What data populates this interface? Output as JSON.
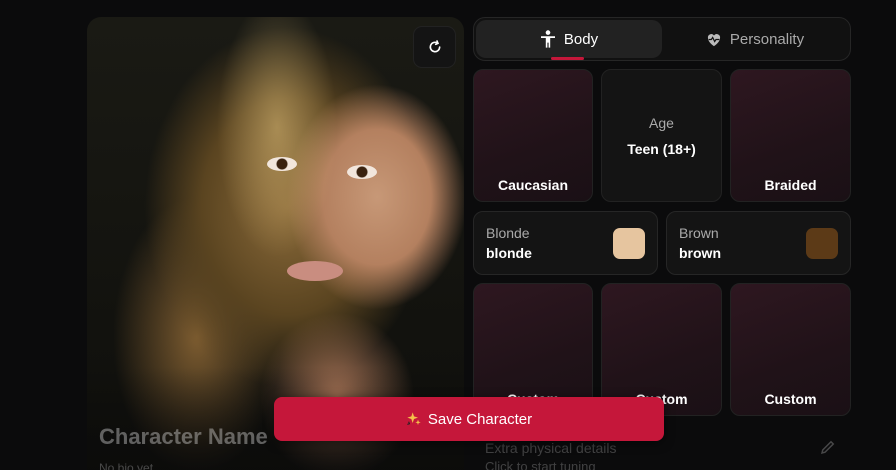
{
  "portrait": {
    "character_name": "Character Name",
    "character_subtitle": "No bio yet"
  },
  "tabs": [
    {
      "label": "Body",
      "icon": "person-icon",
      "active": true
    },
    {
      "label": "Personality",
      "icon": "heart-pulse-icon",
      "active": false
    }
  ],
  "body_options": {
    "ethnicity": "Caucasian",
    "age": {
      "title": "Age",
      "value": "Teen (18+)"
    },
    "hair_style": "Braided",
    "hair_color": {
      "title": "Blonde",
      "value": "blonde",
      "swatch": "#e6c59f"
    },
    "eye_color": {
      "title": "Brown",
      "value": "brown",
      "swatch": "#5c3a17"
    },
    "custom_tiles": [
      "Custom",
      "Custom",
      "Custom"
    ]
  },
  "extra_details": {
    "title": "Extra physical details",
    "hint": "Click to start tuning"
  },
  "save_button": {
    "label": "Save Character",
    "icon": "sparkles-icon"
  },
  "colors": {
    "accent": "#c5173a",
    "background": "#0b0b0c",
    "tile": "#141414"
  }
}
